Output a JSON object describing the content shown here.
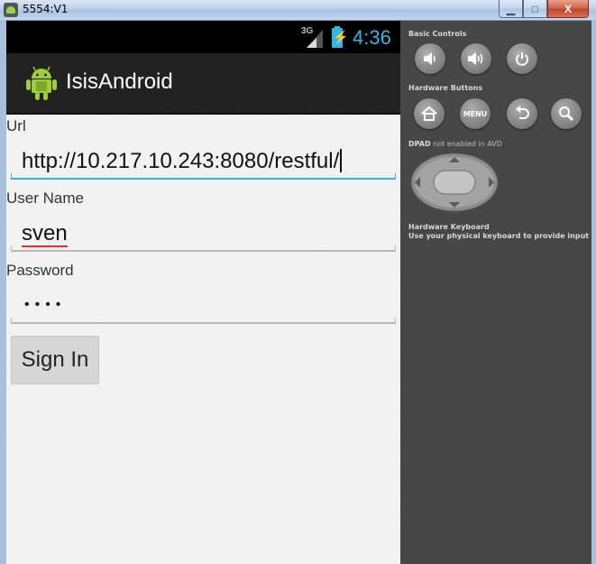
{
  "window": {
    "title": "5554:V1",
    "minimize_label": "▁",
    "maximize_label": "□",
    "close_label": "X"
  },
  "statusbar": {
    "network": "3G",
    "time": "4:36"
  },
  "actionbar": {
    "title": "IsisAndroid"
  },
  "form": {
    "url_label": "Url",
    "url_value": "http://10.217.10.243:8080/restful/",
    "username_label": "User Name",
    "username_value": "sven",
    "password_label": "Password",
    "password_value": "••••",
    "signin_label": "Sign In"
  },
  "controls": {
    "basic_heading": "Basic Controls",
    "hardware_heading": "Hardware Buttons",
    "menu_label": "MENU",
    "dpad_note_bold": "DPAD",
    "dpad_note_rest": "not enabled in AVD",
    "keyboard_line1": "Hardware Keyboard",
    "keyboard_line2": "Use your physical keyboard to provide input"
  },
  "colors": {
    "accent": "#33b5e5",
    "actionbar": "#222222",
    "panel": "#474747"
  }
}
